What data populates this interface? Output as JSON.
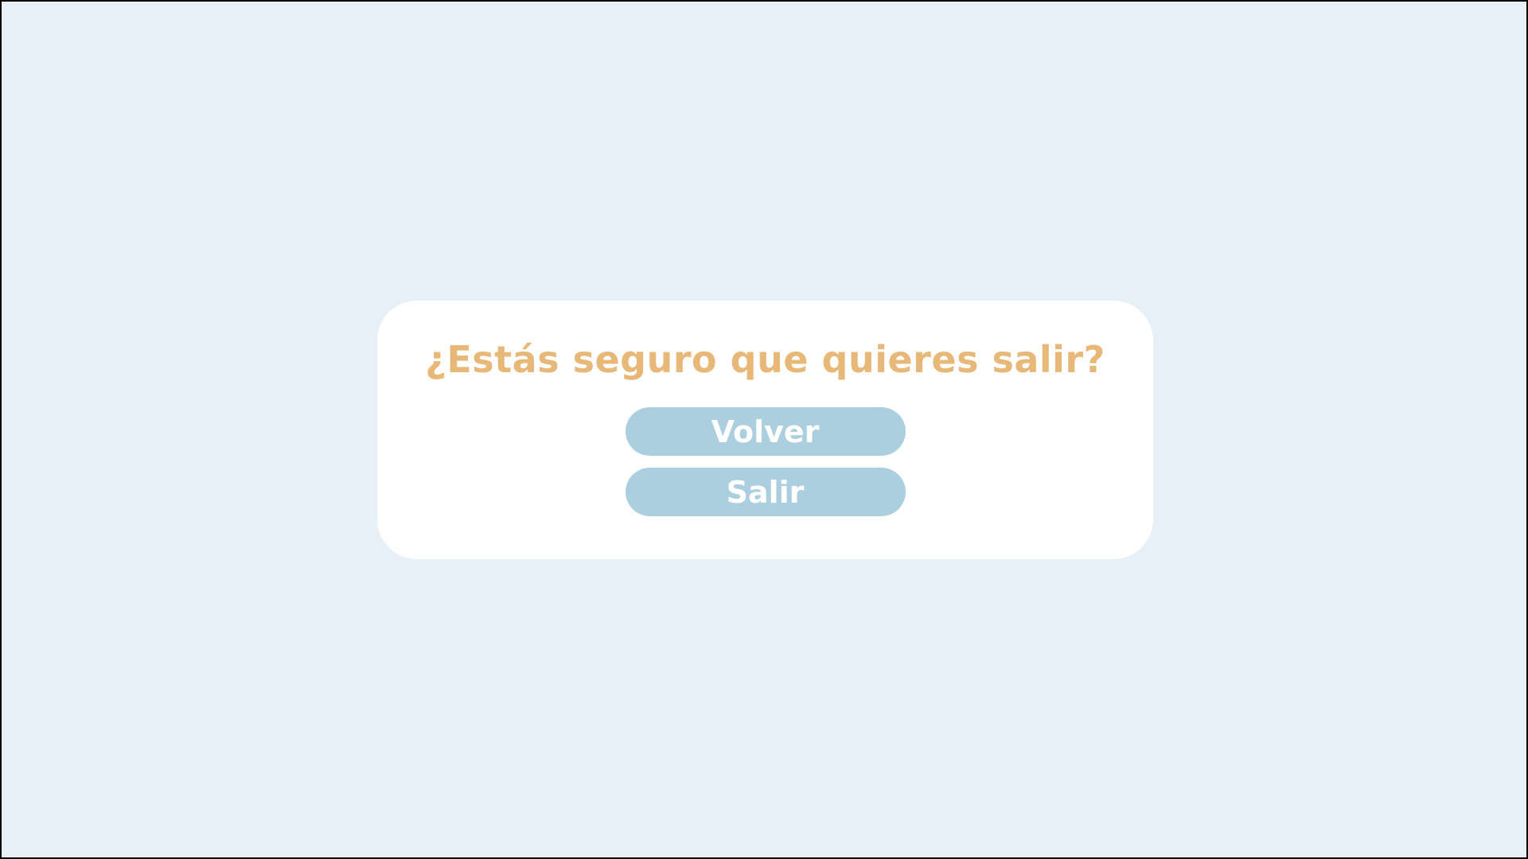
{
  "dialog": {
    "title": "¿Estás seguro que quieres salir?",
    "back_label": "Volver",
    "exit_label": "Salir"
  },
  "colors": {
    "background": "#e8f0f7",
    "dialog": "#ffffff",
    "title": "#e8b878",
    "button": "#accfe0",
    "button_text": "#ffffff"
  }
}
